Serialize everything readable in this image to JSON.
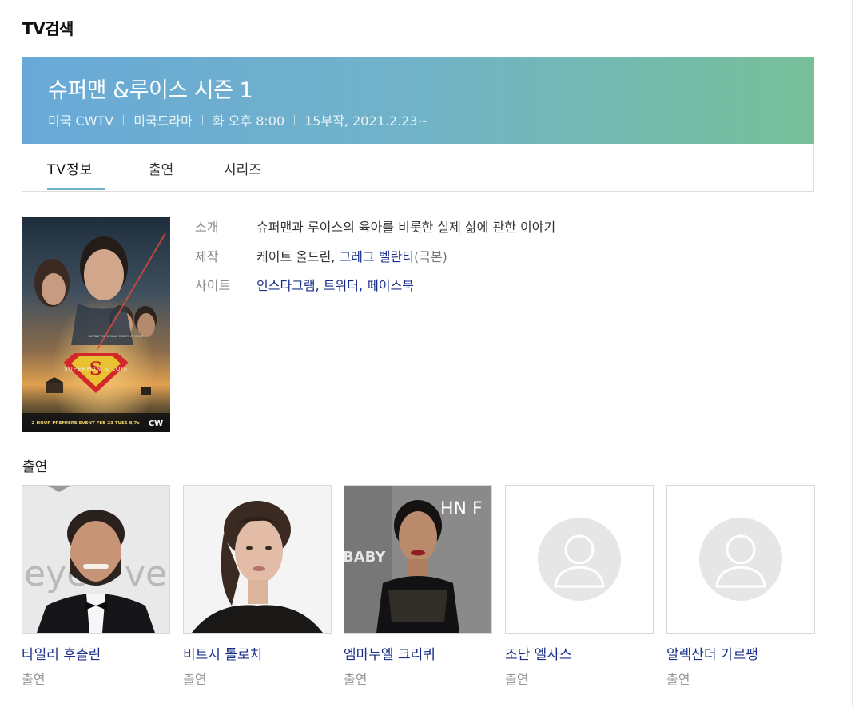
{
  "section_title": "TV검색",
  "banner": {
    "title": "슈퍼맨 &루이스 시즌 1",
    "meta": [
      "미국 CWTV",
      "미국드라마",
      "화 오후 8:00",
      "15부작, 2021.2.23~"
    ]
  },
  "tabs": [
    {
      "label": "TV정보",
      "active": true
    },
    {
      "label": "출연",
      "active": false
    },
    {
      "label": "시리즈",
      "active": false
    }
  ],
  "poster": {
    "tagline": "SAVING THE WORLD STARTS AT HOME",
    "logo": "SUPERMAN & LOIS",
    "premiere": "2-HOUR PREMIERE EVENT FEB 23 TUES 8/7c",
    "network": "CW"
  },
  "info": {
    "intro_label": "소개",
    "intro_value": "슈퍼맨과 루이스의 육아를 비롯한 실제 삶에 관한 이야기",
    "production_label": "제작",
    "production_plain": "케이트 올드린, ",
    "production_link": "그레그 벨란티",
    "production_suffix": "(극본)",
    "site_label": "사이트",
    "sites": [
      "인스타그램",
      "트위터",
      "페이스북"
    ],
    "site_separator": ", "
  },
  "cast_title": "출연",
  "cast": [
    {
      "name": "타일러 후츨린",
      "role": "출연",
      "has_photo": true
    },
    {
      "name": "비트시 톨로치",
      "role": "출연",
      "has_photo": true
    },
    {
      "name": "엠마누엘 크리퀴",
      "role": "출연",
      "has_photo": true
    },
    {
      "name": "조단 엘사스",
      "role": "출연",
      "has_photo": false
    },
    {
      "name": "알렉산더 가르팽",
      "role": "출연",
      "has_photo": false
    }
  ],
  "photo_texts": {
    "c1": "eye",
    "c1b": "ve",
    "c3a": "BABY",
    "c3b": "HN F"
  },
  "colors": {
    "banner_start": "#69a9d8",
    "banner_end": "#77bf98",
    "link": "#1a2f8a",
    "tab_underline": "#6fb0c2"
  }
}
